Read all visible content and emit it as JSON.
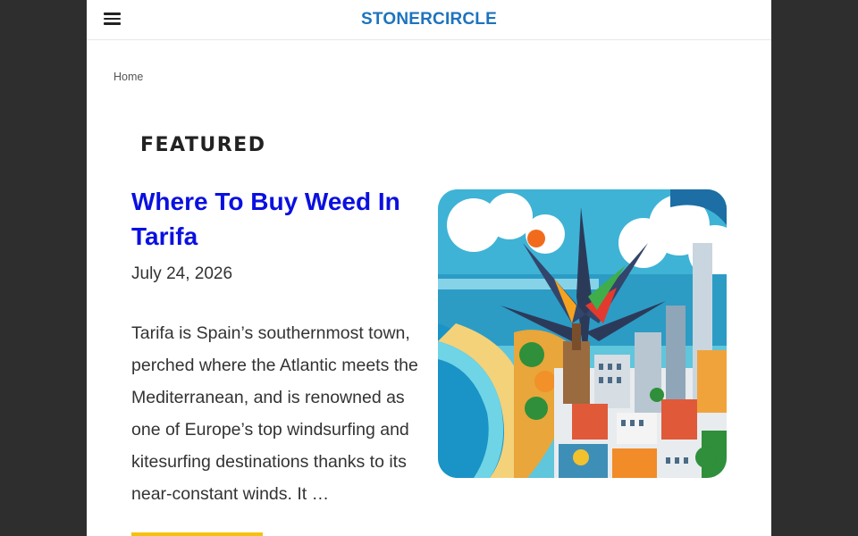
{
  "header": {
    "menu_icon": "hamburger-menu-icon",
    "site_title": "STONERCIRCLE"
  },
  "breadcrumb": {
    "home": "Home"
  },
  "featured": {
    "heading": "FEATURED",
    "post": {
      "title": "Where To Buy Weed In Tarifa",
      "date": "July 24, 2026",
      "excerpt": "Tarifa is Spain’s southernmost town, perched where the Atlantic meets the Mediterranean, and is renowned as one of Europe’s top windsurfing and kitesurfing destinations thanks to its near-constant winds. It …",
      "accent_color": "#f4c20d"
    }
  },
  "colors": {
    "background": "#2e2e2e",
    "title_link": "#0a10e0",
    "brand": "#1e73be"
  }
}
